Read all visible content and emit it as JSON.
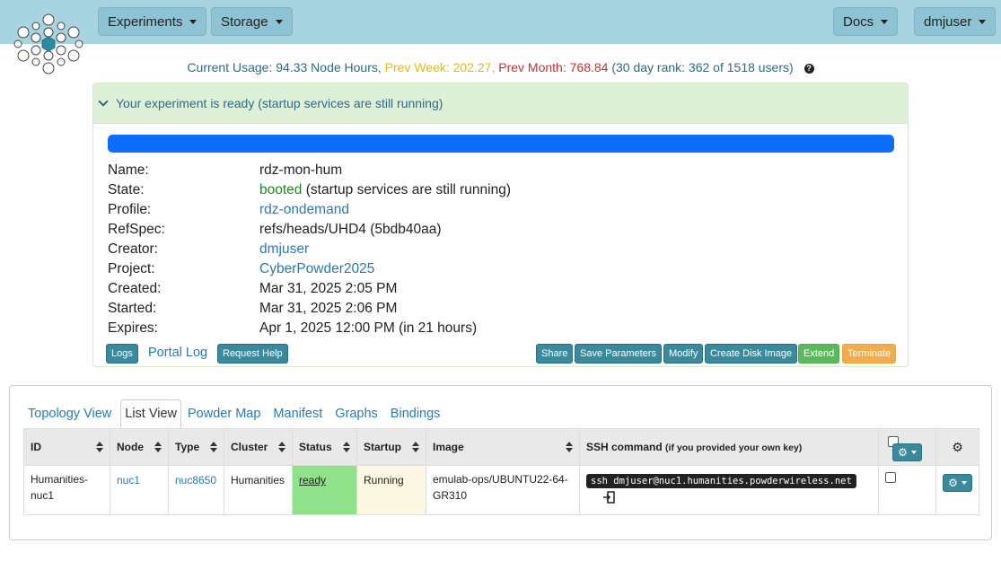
{
  "nav": {
    "experiments": "Experiments",
    "storage": "Storage",
    "docs": "Docs",
    "user": "dmjuser"
  },
  "usage": {
    "current": "Current Usage: 94.33 Node Hours,",
    "prev_week": "Prev Week: 202.27,",
    "prev_month": "Prev Month: 768.84",
    "rank": "(30 day rank: 362 of 1518 users)",
    "help": "?"
  },
  "experiment": {
    "status_heading": "Your experiment is ready (startup services are still running)",
    "progress": 1.0,
    "labels": {
      "name": "Name:",
      "state": "State:",
      "profile": "Profile:",
      "refspec": "RefSpec:",
      "creator": "Creator:",
      "project": "Project:",
      "created": "Created:",
      "started": "Started:",
      "expires": "Expires:"
    },
    "name": "rdz-mon-hum",
    "state": "booted",
    "state_note": "(startup services are still running)",
    "profile": "rdz-ondemand",
    "refspec": "refs/heads/UHD4 (5bdb40aa)",
    "creator": "dmjuser",
    "project": "CyberPowder2025",
    "created": "Mar 31, 2025 2:05 PM",
    "started": "Mar 31, 2025 2:06 PM",
    "expires": "Apr 1, 2025 12:00 PM (in 21 hours)",
    "buttons": {
      "logs": "Logs",
      "portal_log": "Portal Log",
      "request_help": "Request Help",
      "share": "Share",
      "save_parameters": "Save Parameters",
      "modify": "Modify",
      "create_disk_image": "Create Disk Image",
      "extend": "Extend",
      "terminate": "Terminate"
    }
  },
  "tabs": [
    "Topology View",
    "List View",
    "Powder Map",
    "Manifest",
    "Graphs",
    "Bindings"
  ],
  "list": {
    "headers": {
      "id": "ID",
      "node": "Node",
      "type": "Type",
      "cluster": "Cluster",
      "status": "Status",
      "startup": "Startup",
      "image": "Image",
      "ssh": "SSH command",
      "ssh_note": "(if you provided your own key)"
    },
    "rows": [
      {
        "id": "Humanities-nuc1",
        "node": "nuc1",
        "type": "nuc8650",
        "cluster": "Humanities",
        "status": "ready",
        "startup": "Running",
        "image": "emulab-ops/UBUNTU22-64-GR310",
        "ssh": "ssh dmjuser@nuc1.humanities.powderwireless.net"
      }
    ]
  },
  "colors": {
    "navbar": "#a8d3e0",
    "progress": "#0d6efd",
    "ready": "#8fe28a",
    "button": "#3a8a9e"
  }
}
